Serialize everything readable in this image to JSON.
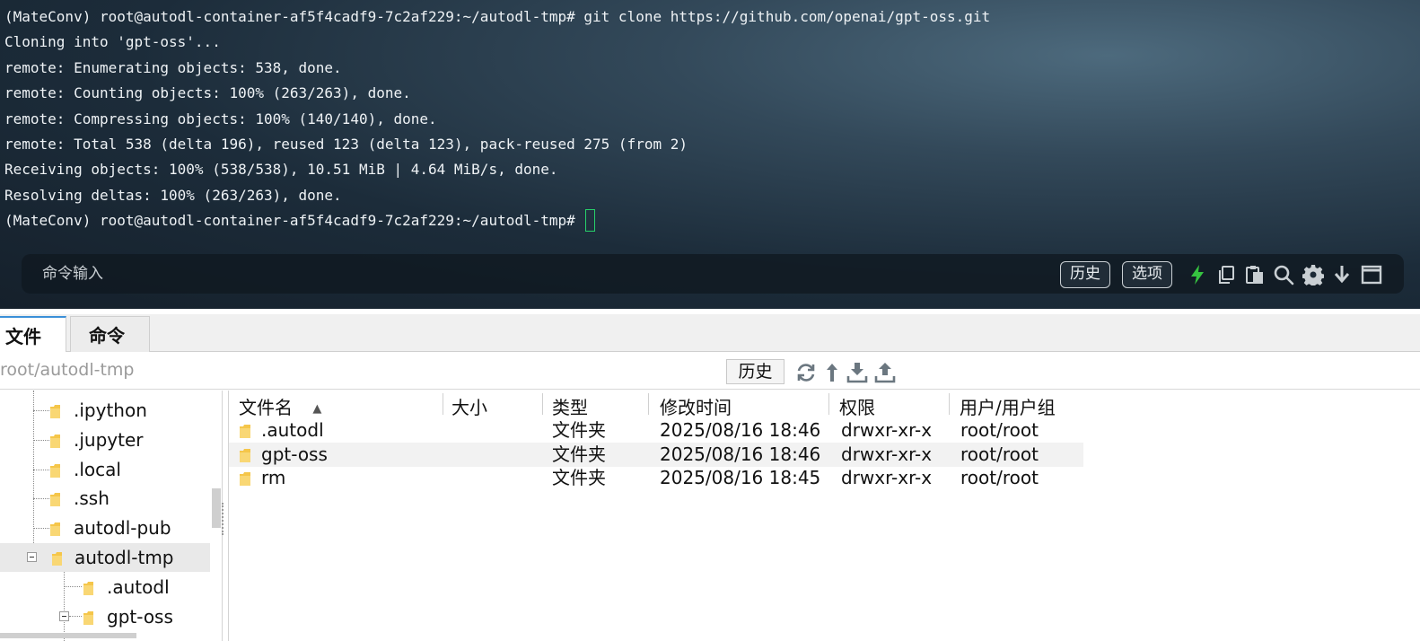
{
  "terminal": {
    "lines": [
      "(MateConv) root@autodl-container-af5f4cadf9-7c2af229:~/autodl-tmp# git clone https://github.com/openai/gpt-oss.git",
      "Cloning into 'gpt-oss'...",
      "remote: Enumerating objects: 538, done.",
      "remote: Counting objects: 100% (263/263), done.",
      "remote: Compressing objects: 100% (140/140), done.",
      "remote: Total 538 (delta 196), reused 123 (delta 123), pack-reused 275 (from 2)",
      "Receiving objects: 100% (538/538), 10.51 MiB | 4.64 MiB/s, done.",
      "Resolving deltas: 100% (263/263), done."
    ],
    "prompt": "(MateConv) root@autodl-container-af5f4cadf9-7c2af229:~/autodl-tmp# ",
    "cursor_color": "#27d06a"
  },
  "command_bar": {
    "placeholder": "命令输入",
    "history_label": "历史",
    "options_label": "选项",
    "icons": [
      "lightning-icon",
      "copy-icon",
      "paste-icon",
      "search-icon",
      "gear-icon",
      "download-arrow-icon",
      "maximize-icon"
    ]
  },
  "tabs": {
    "files": "文件",
    "commands": "命令"
  },
  "pathbar": {
    "path": "root/autodl-tmp",
    "history_label": "历史",
    "icons": [
      "refresh-icon",
      "up-directory-icon",
      "download-icon",
      "upload-icon"
    ]
  },
  "tree": {
    "items": [
      ".ipython",
      ".jupyter",
      ".local",
      ".ssh",
      "autodl-pub",
      "autodl-tmp",
      ".autodl",
      "gpt-oss"
    ],
    "selected": "autodl-tmp"
  },
  "table": {
    "headers": {
      "name": "文件名",
      "size": "大小",
      "type": "类型",
      "modified": "修改时间",
      "permissions": "权限",
      "owner": "用户/用户组"
    },
    "sort_indicator": "▲",
    "rows": [
      {
        "name": ".autodl",
        "size": "",
        "type": "文件夹",
        "modified": "2025/08/16 18:46",
        "permissions": "drwxr-xr-x",
        "owner": "root/root"
      },
      {
        "name": "gpt-oss",
        "size": "",
        "type": "文件夹",
        "modified": "2025/08/16 18:46",
        "permissions": "drwxr-xr-x",
        "owner": "root/root"
      },
      {
        "name": "rm",
        "size": "",
        "type": "文件夹",
        "modified": "2025/08/16 18:45",
        "permissions": "drwxr-xr-x",
        "owner": "root/root"
      }
    ]
  },
  "colors": {
    "accent": "#3b8fd8",
    "folder": "#f5c64a",
    "lightning": "#36c240"
  }
}
